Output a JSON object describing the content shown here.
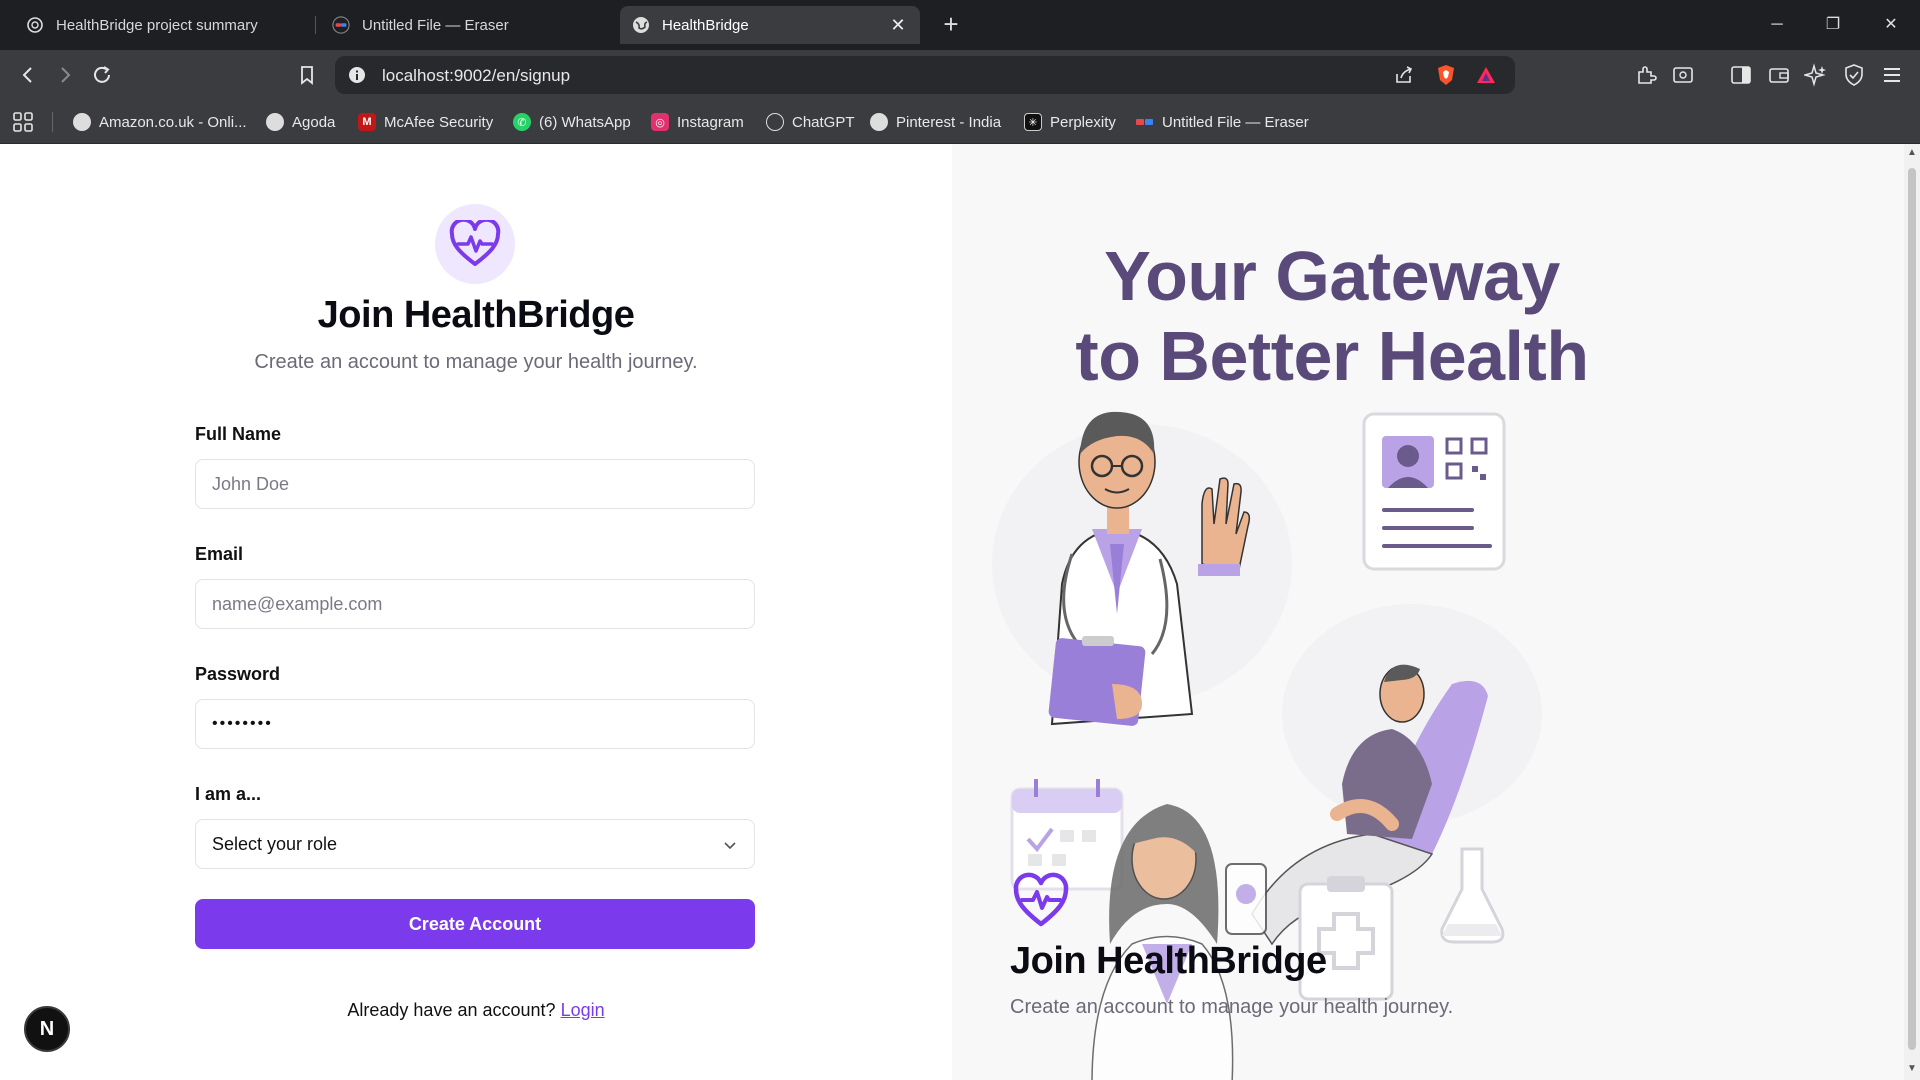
{
  "browser": {
    "tabs": [
      {
        "title": "HealthBridge project summary",
        "icon": "chatgpt-icon",
        "active": false
      },
      {
        "title": "Untitled File — Eraser",
        "icon": "eraser-icon",
        "active": false
      },
      {
        "title": "HealthBridge",
        "icon": "globe-icon",
        "active": true
      }
    ],
    "url": "localhost:9002/en/signup",
    "bookmarks": [
      {
        "label": "Amazon.co.uk - Onli...",
        "icon": "globe-icon"
      },
      {
        "label": "Agoda",
        "icon": "globe-icon"
      },
      {
        "label": "McAfee Security",
        "icon": "mcafee-icon"
      },
      {
        "label": "(6) WhatsApp",
        "icon": "whatsapp-icon"
      },
      {
        "label": "Instagram",
        "icon": "instagram-icon"
      },
      {
        "label": "ChatGPT",
        "icon": "chatgpt-icon"
      },
      {
        "label": "Pinterest - India",
        "icon": "globe-icon"
      },
      {
        "label": "Perplexity",
        "icon": "perplexity-icon"
      },
      {
        "label": "Untitled File — Eraser",
        "icon": "eraser-icon"
      }
    ]
  },
  "signup": {
    "title": "Join HealthBridge",
    "subtitle": "Create an account to manage your health journey.",
    "fields": {
      "full_name": {
        "label": "Full Name",
        "placeholder": "John Doe",
        "value": ""
      },
      "email": {
        "label": "Email",
        "placeholder": "name@example.com",
        "value": ""
      },
      "password": {
        "label": "Password",
        "value": "••••••••"
      },
      "role": {
        "label": "I am a...",
        "value": "Select your role"
      }
    },
    "submit_label": "Create Account",
    "login_prompt": "Already have an account?",
    "login_link": "Login"
  },
  "hero": {
    "title_line1": "Your Gateway",
    "title_line2": "to Better Health",
    "overlay_title": "Join HealthBridge",
    "overlay_subtitle": "Create an account to manage your health journey."
  },
  "dev_badge": "N",
  "colors": {
    "accent": "#7c3aed",
    "accent_light": "#efe7fd",
    "hero_text": "#5a4a7a",
    "illustration_purple": "#b9a3e6"
  }
}
